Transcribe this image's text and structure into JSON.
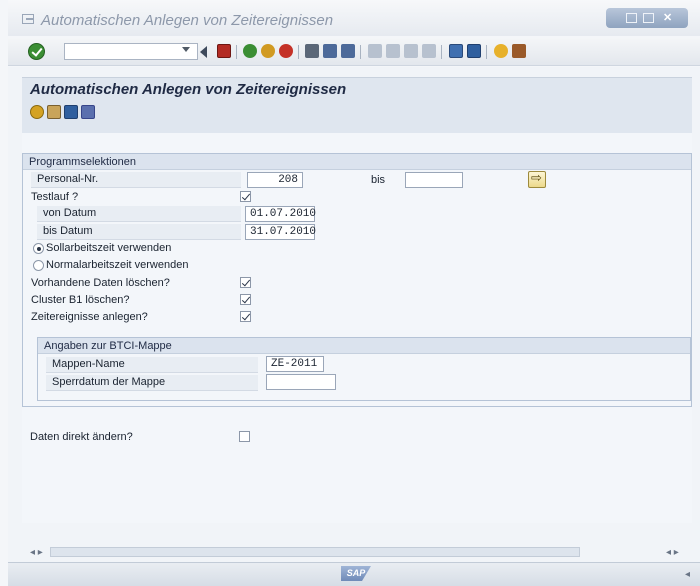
{
  "window": {
    "title": "Automatischen Anlegen von Zeitereignissen"
  },
  "system_toolbar": {
    "command_field_value": ""
  },
  "page": {
    "title": "Automatischen Anlegen von Zeitereignissen"
  },
  "selection_group": {
    "title": "Programmselektionen",
    "personal_nr_label": "Personal-Nr.",
    "personal_nr_value": "208",
    "bis_label": "bis",
    "bis_value": "",
    "testlauf_label": "Testlauf ?",
    "testlauf_checked": true,
    "von_datum_label": "von Datum",
    "von_datum_value": "01.07.2010",
    "bis_datum_label": "bis Datum",
    "bis_datum_value": "31.07.2010",
    "radio_soll_label": "Sollarbeitszeit verwenden",
    "radio_normal_label": "Normalarbeitszeit verwenden",
    "vorhandene_label": "Vorhandene Daten löschen?",
    "vorhandene_checked": true,
    "cluster_label": "Cluster B1 löschen?",
    "cluster_checked": true,
    "zeitereignisse_label": "Zeitereignisse anlegen?",
    "zeitereignisse_checked": true
  },
  "btci_group": {
    "title": "Angaben zur BTCI-Mappe",
    "mappen_label": "Mappen-Name",
    "mappen_value": "ZE-2011",
    "sperrdatum_label": "Sperrdatum der Mappe",
    "sperrdatum_value": ""
  },
  "daten_direkt_label": "Daten direkt ändern?",
  "daten_direkt_checked": false,
  "status_bar": {
    "logo_text": "SAP"
  }
}
